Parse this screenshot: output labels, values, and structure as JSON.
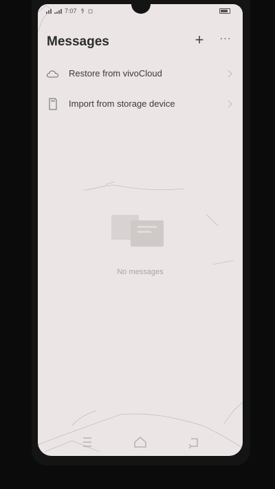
{
  "status_bar": {
    "time": "7:07",
    "carrier_glyph": "⚏"
  },
  "header": {
    "title": "Messages",
    "add_glyph": "+",
    "more_glyph": "···"
  },
  "options": [
    {
      "label": "Restore from vivoCloud",
      "icon": "cloud-icon"
    },
    {
      "label": "Import from storage device",
      "icon": "sd-card-icon"
    }
  ],
  "empty_state": {
    "text": "No messages"
  },
  "colors": {
    "screen_bg": "#ebe6e5",
    "text_primary": "#2b2b2b",
    "text_muted": "#a8a4a3"
  }
}
